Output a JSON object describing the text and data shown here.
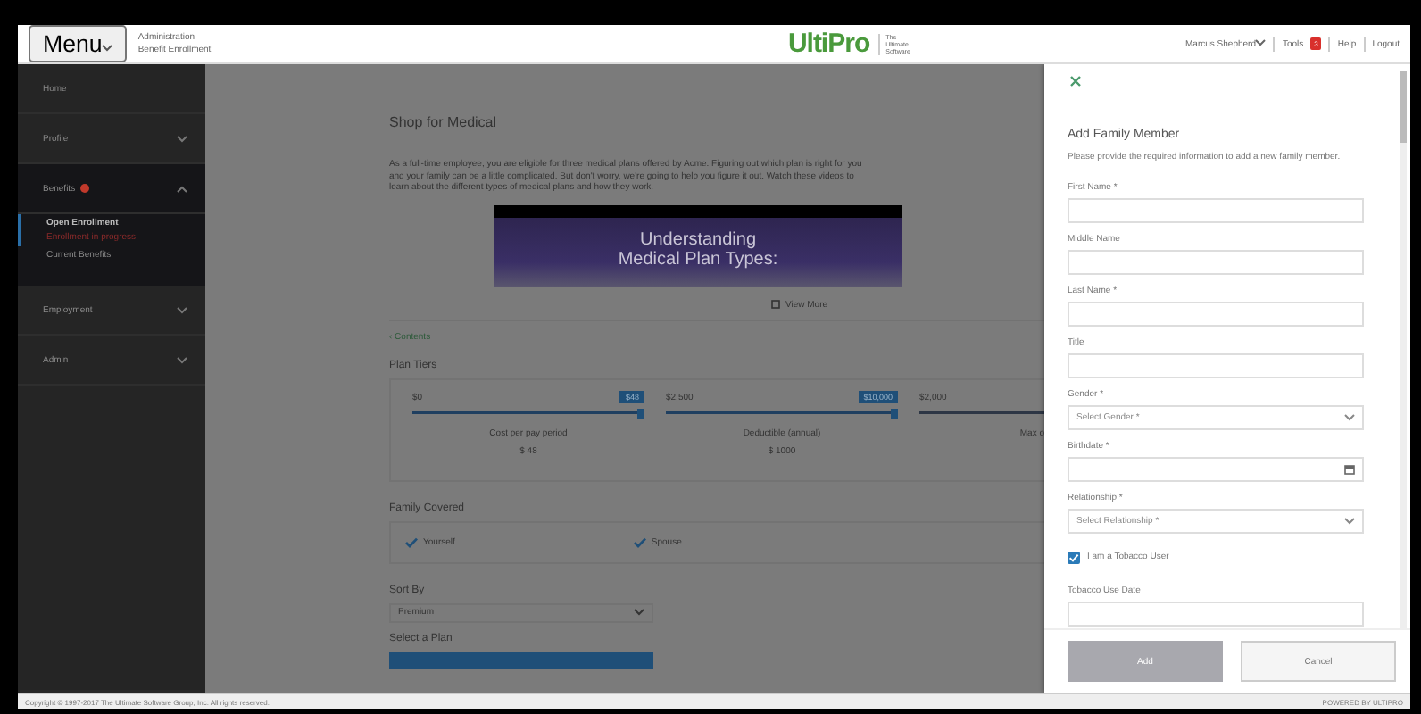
{
  "header": {
    "menu_button": "Menu",
    "context_lines": [
      "Administration",
      "Benefit Enrollment"
    ],
    "logo": "UltiPro",
    "logo_tagline": [
      "The",
      "Ultimate",
      "Software"
    ],
    "user": "Marcus Shepherd",
    "tools": "Tools",
    "tools_badge": "3",
    "links": [
      "Help",
      "Logout"
    ]
  },
  "sidebar": {
    "items": [
      {
        "label": "Home",
        "kind": "link"
      },
      {
        "label": "Profile",
        "kind": "group",
        "expanded": false,
        "alert": false
      },
      {
        "label": "Benefits",
        "kind": "group",
        "expanded": true,
        "alert": true,
        "children": [
          {
            "label": "Open Enrollment",
            "selected": true,
            "note": "Enrollment in progress"
          },
          {
            "label": "Current Benefits",
            "selected": false
          }
        ]
      },
      {
        "label": "Employment",
        "kind": "group",
        "expanded": false,
        "alert": false
      },
      {
        "label": "Admin",
        "kind": "group",
        "expanded": false,
        "alert": false
      }
    ]
  },
  "main": {
    "title": "Shop for Medical",
    "intro": "As a full-time employee, you are eligible for three medical plans offered by Acme. Figuring out which plan is right for you and your family can be a little complicated. But don't worry, we're going to help you figure it out. Watch these videos to learn about the different types of medical plans and how they work.",
    "video": {
      "title_lines": [
        "Understanding",
        "Medical Plan Types:"
      ]
    },
    "view_more": "View More",
    "back_link": "‹ Contents",
    "plan_tiers": {
      "title": "Plan Tiers",
      "sliders": [
        {
          "min": "$0",
          "value": "$48",
          "level": 1,
          "caption": "Cost per pay period",
          "reading": "$ 48"
        },
        {
          "min": "$2,500",
          "value": "$10,000",
          "level": 1,
          "caption": "Deductible (annual)",
          "reading": "$ 1000"
        },
        {
          "min": "$2,000",
          "caption": "Max o"
        }
      ]
    },
    "family": {
      "title": "Family Covered",
      "members": [
        {
          "name": "Yourself",
          "checked": true
        },
        {
          "name": "Spouse",
          "checked": true
        }
      ]
    },
    "sort": {
      "label": "Sort By",
      "value": "Premium"
    },
    "select_plan": "Select a Plan"
  },
  "drawer": {
    "title": "Add Family Member",
    "description": "Please provide the required information to add a new family member.",
    "fields": [
      {
        "kind": "text",
        "label": "First Name *"
      },
      {
        "kind": "text",
        "label": "Middle Name"
      },
      {
        "kind": "text",
        "label": "Last Name *"
      },
      {
        "kind": "text",
        "label": "Title"
      },
      {
        "kind": "select",
        "label": "Gender *",
        "placeholder": "Select Gender *"
      },
      {
        "kind": "date",
        "label": "Birthdate *"
      },
      {
        "kind": "select",
        "label": "Relationship *",
        "placeholder": "Select Relationship *"
      },
      {
        "kind": "checkbox",
        "label": "I am a Tobacco User",
        "checked": true
      },
      {
        "kind": "text",
        "label": "Tobacco Use Date"
      }
    ],
    "buttons": [
      {
        "label": "Add",
        "disabled": true
      },
      {
        "label": "Cancel",
        "disabled": false
      }
    ]
  },
  "footer": {
    "copyright": "Copyright © 1997-2017 The Ultimate Software Group, Inc. All rights reserved.",
    "right_text": "POWERED BY ULTIPRO"
  }
}
